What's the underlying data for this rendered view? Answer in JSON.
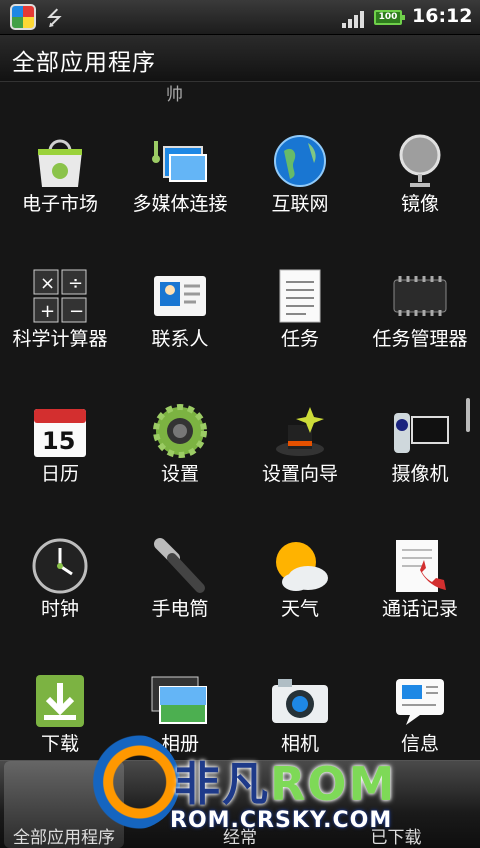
{
  "status": {
    "time": "16:12",
    "battery": "100"
  },
  "header": {
    "title": "全部应用程序",
    "scroll_hint": "帅"
  },
  "apps": [
    {
      "label": "电子市场",
      "icon": "market-icon"
    },
    {
      "label": "多媒体连接",
      "icon": "media-link-icon"
    },
    {
      "label": "互联网",
      "icon": "globe-icon"
    },
    {
      "label": "镜像",
      "icon": "mirror-icon"
    },
    {
      "label": "科学计算器",
      "icon": "calculator-icon"
    },
    {
      "label": "联系人",
      "icon": "contacts-icon"
    },
    {
      "label": "任务",
      "icon": "tasks-icon"
    },
    {
      "label": "任务管理器",
      "icon": "chip-icon"
    },
    {
      "label": "日历",
      "icon": "calendar-icon",
      "badge": "15"
    },
    {
      "label": "设置",
      "icon": "settings-gear-icon"
    },
    {
      "label": "设置向导",
      "icon": "wizard-hat-icon"
    },
    {
      "label": "摄像机",
      "icon": "camcorder-icon"
    },
    {
      "label": "时钟",
      "icon": "clock-icon"
    },
    {
      "label": "手电筒",
      "icon": "flashlight-icon"
    },
    {
      "label": "天气",
      "icon": "weather-icon"
    },
    {
      "label": "通话记录",
      "icon": "call-log-icon"
    },
    {
      "label": "下载",
      "icon": "download-icon"
    },
    {
      "label": "相册",
      "icon": "gallery-icon"
    },
    {
      "label": "相机",
      "icon": "camera-icon"
    },
    {
      "label": "信息",
      "icon": "messages-icon"
    }
  ],
  "tabs": [
    {
      "label": "全部应用程序",
      "active": true
    },
    {
      "label": "经常",
      "active": false
    },
    {
      "label": "已下载",
      "active": false
    }
  ],
  "watermark": {
    "brand": "非凡",
    "brand_rom": "ROM",
    "url": "ROM.CRSKY.COM"
  }
}
